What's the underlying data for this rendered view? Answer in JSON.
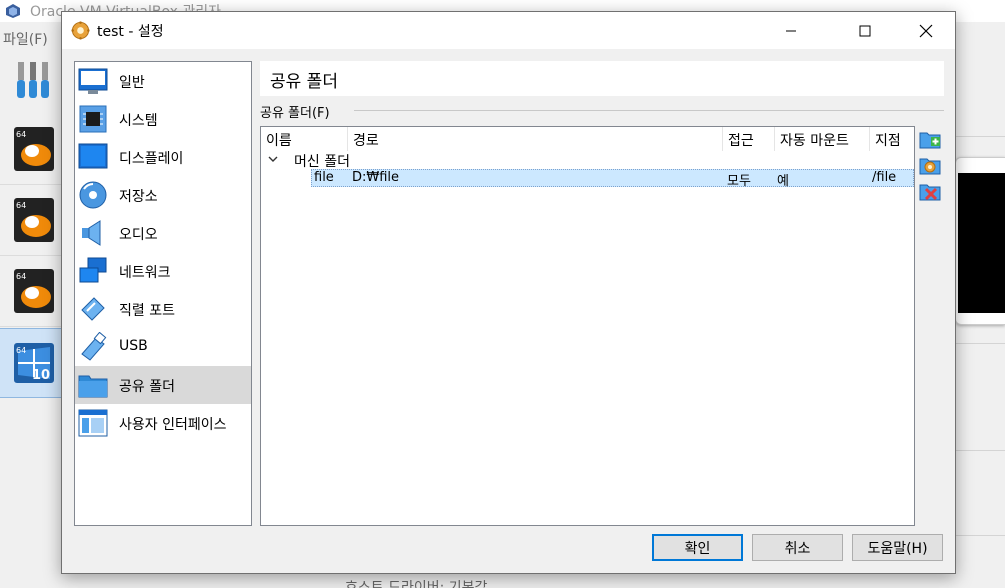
{
  "background": {
    "window_title": "Oracle VM VirtualBox 관리자",
    "menu": "파일(F)",
    "status_text": "호스트 드라이버: 기본값"
  },
  "dialog": {
    "title": "test - 설정",
    "categories": [
      {
        "label": "일반",
        "icon": "monitor-icon"
      },
      {
        "label": "시스템",
        "icon": "chip-icon"
      },
      {
        "label": "디스플레이",
        "icon": "display-icon"
      },
      {
        "label": "저장소",
        "icon": "disk-icon"
      },
      {
        "label": "오디오",
        "icon": "speaker-icon"
      },
      {
        "label": "네트워크",
        "icon": "network-icon"
      },
      {
        "label": "직렬 포트",
        "icon": "serial-port-icon"
      },
      {
        "label": "USB",
        "icon": "usb-icon"
      },
      {
        "label": "공유 폴더",
        "icon": "folder-icon",
        "selected": true
      },
      {
        "label": "사용자 인터페이스",
        "icon": "ui-icon"
      }
    ],
    "page_title": "공유 폴더",
    "group_label": "공유 폴더(F)",
    "columns": [
      "이름",
      "경로",
      "접근",
      "자동 마운트",
      "지점"
    ],
    "tree_group": "머신 폴더",
    "rows": [
      {
        "name": "file",
        "path": "D:₩file",
        "access": "모두",
        "auto_mount": "예",
        "point": "/file"
      }
    ],
    "buttons": {
      "ok": "확인",
      "cancel": "취소",
      "help": "도움말(H)"
    }
  }
}
